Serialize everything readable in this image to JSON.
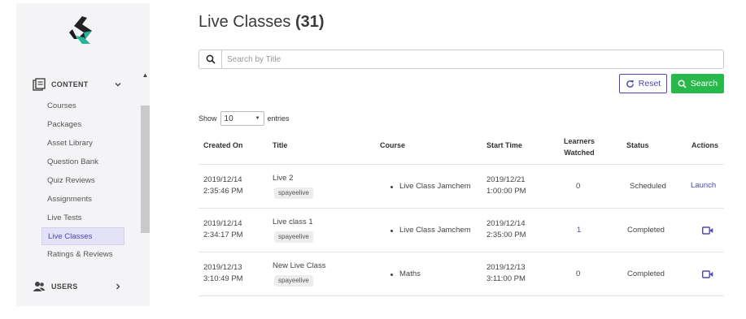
{
  "colors": {
    "accent": "#4d46b8",
    "success": "#28b94b",
    "sidebar_bg": "#f4f4f6"
  },
  "sidebar": {
    "logo_icon": "brand-logo",
    "sections": [
      {
        "label": "CONTENT",
        "icon": "content-icon",
        "expanded": true
      },
      {
        "label": "USERS",
        "icon": "users-icon",
        "expanded": false
      }
    ],
    "items": [
      {
        "label": "Courses"
      },
      {
        "label": "Packages"
      },
      {
        "label": "Asset Library"
      },
      {
        "label": "Question Bank"
      },
      {
        "label": "Quiz Reviews"
      },
      {
        "label": "Assignments"
      },
      {
        "label": "Live Tests"
      },
      {
        "label": "Live Classes",
        "active": true
      },
      {
        "label": "Ratings & Reviews"
      }
    ]
  },
  "page": {
    "title": "Live Classes",
    "count": "(31)"
  },
  "search": {
    "placeholder": "Search by Title",
    "value": ""
  },
  "buttons": {
    "reset": "Reset",
    "search": "Search"
  },
  "length_menu": {
    "show": "Show",
    "value": "10",
    "entries": "entries"
  },
  "table": {
    "headers": [
      "Created On",
      "Title",
      "Course",
      "Start Time",
      "Learners",
      "Watched",
      "Status",
      "Actions"
    ],
    "rows": [
      {
        "created_date": "2019/12/14",
        "created_time": "2:35:46 PM",
        "title": "Live 2",
        "tag": "spayeelive",
        "course": "Live Class Jamchem",
        "start_date": "2019/12/21",
        "start_time": "1:00:00 PM",
        "learners": "0",
        "status": "Scheduled",
        "action": "Launch"
      },
      {
        "created_date": "2019/12/14",
        "created_time": "2:34:17 PM",
        "title": "Live class 1",
        "tag": "spayeelive",
        "course": "Live Class Jamchem",
        "start_date": "2019/12/14",
        "start_time": "2:35:00 PM",
        "learners": "1",
        "status": "Completed",
        "action_icon": "video-camera-icon"
      },
      {
        "created_date": "2019/12/13",
        "created_time": "3:10:49 PM",
        "title": "New Live Class",
        "tag": "spayeelive",
        "course": "Maths",
        "start_date": "2019/12/13",
        "start_time": "3:11:00 PM",
        "learners": "0",
        "status": "Completed",
        "action_icon": "video-camera-icon"
      }
    ]
  }
}
